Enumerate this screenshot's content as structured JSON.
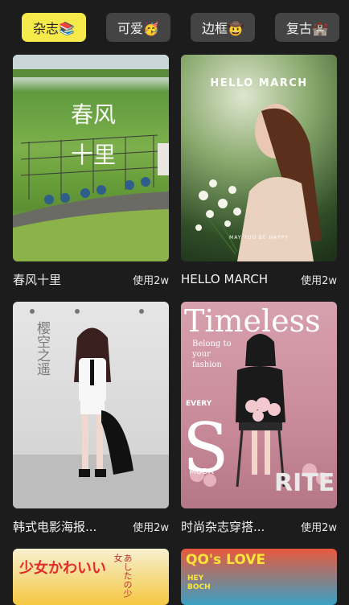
{
  "tabs": [
    {
      "label": "杂志📚",
      "active": true
    },
    {
      "label": "可爱🥳",
      "active": false
    },
    {
      "label": "边框🤠",
      "active": false
    },
    {
      "label": "复古🏰",
      "active": false
    }
  ],
  "cards": [
    {
      "title": "春风十里",
      "usage": "使用2w",
      "poster_text": "春风十里",
      "poster_sub": "春风十里"
    },
    {
      "title": "HELLO MARCH",
      "usage": "使用2w",
      "poster_text": "HELLO MARCH",
      "poster_sub": "MAY YOU BE HAPPY"
    },
    {
      "title": "韩式电影海报...",
      "usage": "使用2w",
      "poster_text": "樱空之遥",
      "poster_sub": ""
    },
    {
      "title": "时尚杂志穿搭...",
      "usage": "使用2w",
      "poster_text": "Timeless",
      "poster_sub": "Belong to your fashion",
      "poster_s": "S",
      "poster_moda": "MODA",
      "poster_rite": "RITE",
      "poster_every": "EVERY"
    },
    {
      "poster_text": "少女かわいい",
      "poster_sub": "あしたの少女"
    },
    {
      "poster_text": "QO's LOVE",
      "poster_sub": "HEY BOCH"
    }
  ],
  "colors": {
    "background": "#1c1c1c",
    "tab_active": "#f6e94a",
    "tab_inactive": "#444444"
  }
}
